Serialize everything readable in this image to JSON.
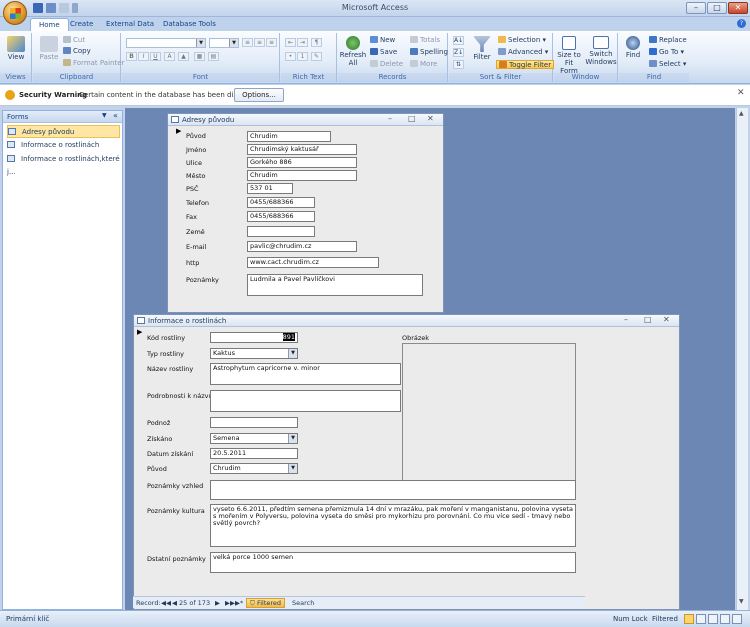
{
  "window": {
    "title": "Microsoft Access",
    "minimize": "–",
    "maximize": "□",
    "close": "✕"
  },
  "ribbon": {
    "tabs": [
      "Home",
      "Create",
      "External Data",
      "Database Tools"
    ],
    "groups": {
      "views": {
        "label": "Views",
        "view": "View"
      },
      "clipboard": {
        "label": "Clipboard",
        "paste": "Paste",
        "cut": "Cut",
        "copy": "Copy",
        "format_painter": "Format Painter"
      },
      "font": {
        "label": "Font"
      },
      "rich_text": {
        "label": "Rich Text"
      },
      "records": {
        "label": "Records",
        "refresh": "Refresh All",
        "new": "New",
        "save": "Save",
        "delete": "Delete",
        "totals": "Totals",
        "spelling": "Spelling",
        "more": "More"
      },
      "sort_filter": {
        "label": "Sort & Filter",
        "filter": "Filter",
        "selection": "Selection",
        "advanced": "Advanced",
        "toggle_filter": "Toggle Filter"
      },
      "window": {
        "label": "Window",
        "size_to_fit": "Size to Fit Form",
        "switch_windows": "Switch Windows"
      },
      "find": {
        "label": "Find",
        "find": "Find",
        "replace": "Replace",
        "goto": "Go To",
        "select": "Select"
      }
    }
  },
  "security": {
    "title": "Security Warning",
    "message": "Certain content in the database has been disabled",
    "options": "Options..."
  },
  "nav": {
    "title": "Forms",
    "items": [
      "Adresy původu",
      "Informace o rostlinách",
      "Informace o rostlinách,které j..."
    ]
  },
  "form1": {
    "title": "Adresy původu",
    "fields": [
      {
        "label": "Původ",
        "value": "Chrudim"
      },
      {
        "label": "Jméno",
        "value": "Chrudimský kaktusář"
      },
      {
        "label": "Ulice",
        "value": "Gorkého 886"
      },
      {
        "label": "Město",
        "value": "Chrudim"
      },
      {
        "label": "PSČ",
        "value": "537 01"
      },
      {
        "label": "Telefon",
        "value": "0455/688366"
      },
      {
        "label": "Fax",
        "value": "0455/688366"
      },
      {
        "label": "Země",
        "value": ""
      },
      {
        "label": "E-mail",
        "value": "pavlic@chrudim.cz"
      },
      {
        "label": "http",
        "value": "www.cact.chrudim.cz"
      },
      {
        "label": "Poznámky",
        "value": "Ludmila a Pavel Pavlíčkovi"
      }
    ]
  },
  "form2": {
    "title": "Informace o rostlinách",
    "kod": {
      "label": "Kód rostliny",
      "value": "891"
    },
    "typ": {
      "label": "Typ rostliny",
      "value": "Kaktus"
    },
    "nazev": {
      "label": "Název rostliny",
      "value": "Astrophytum capricorne v. minor"
    },
    "podrobnosti": {
      "label": "Podrobnosti k názvu",
      "value": ""
    },
    "podnoz": {
      "label": "Podnož",
      "value": ""
    },
    "ziskano": {
      "label": "Získáno",
      "value": "Semena"
    },
    "datum": {
      "label": "Datum získání",
      "value": "20.5.2011"
    },
    "puvod": {
      "label": "Původ",
      "value": "Chrudim"
    },
    "obrazek": {
      "label": "Obrázek"
    },
    "vzhled": {
      "label": "Poznámky vzhled",
      "value": ""
    },
    "kultura": {
      "label": "Poznámky kultura",
      "value": "vyseto 6.6.2011, předtím semena přemizmula 14 dní v mrazáku, pak moření v manganistanu, polovina vyseta s mořením v Polyversu, polovina vyseta do směsi pro mykorhizu pro porovnání. Co mu více sedí - tmavý nebo světlý povrch?"
    },
    "ostatni": {
      "label": "Dstatní poznámky",
      "value": "velká porce 1000 semen"
    }
  },
  "recnav": {
    "label": "Record:",
    "first": "◀◀",
    "prev": "◀",
    "position": "25 of 173",
    "next": "▶",
    "last": "▶▶",
    "new": "▶*",
    "filtered": "Filtered",
    "search": "Search"
  },
  "status": {
    "left": "Primární klíč",
    "numlock": "Num Lock",
    "filtered": "Filtered"
  }
}
